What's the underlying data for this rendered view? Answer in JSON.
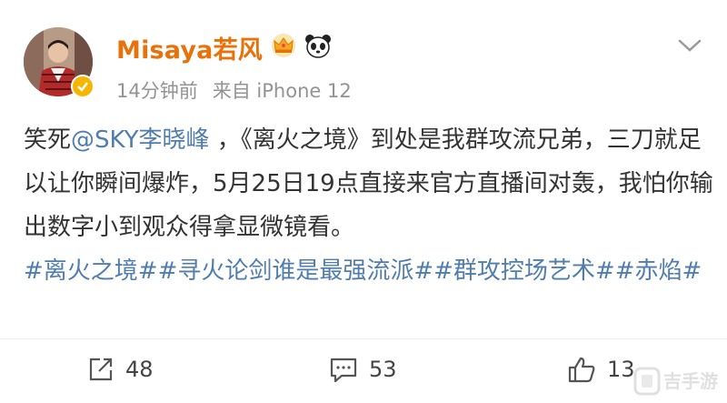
{
  "author": {
    "name": "Misaya若风",
    "avatar_icon": "user-avatar",
    "badge_icon": "verified-badge-icon",
    "badge_color": "#f7b500",
    "name_color": "#e8710a",
    "title_icons": [
      "crown-icon",
      "panda-icon"
    ]
  },
  "meta": {
    "time": "14分钟前",
    "source": "来自 iPhone 12"
  },
  "post": {
    "prefix": "笑死",
    "mention": "@SKY李晓峰",
    "body": " ，《离火之境》到处是我群攻流兄弟，三刀就足以让你瞬间爆炸，5月25日19点直接来官方直播间对轰，我怕你输出数字小到观众得拿显微镜看。",
    "hashtags": "#离火之境##寻火论剑谁是最强流派##群攻控场艺术##赤焰#",
    "link_color": "#507daf"
  },
  "actions": {
    "repost_count": "48",
    "comment_count": "53",
    "like_count": "13"
  },
  "watermark": {
    "text": "吉手游"
  }
}
